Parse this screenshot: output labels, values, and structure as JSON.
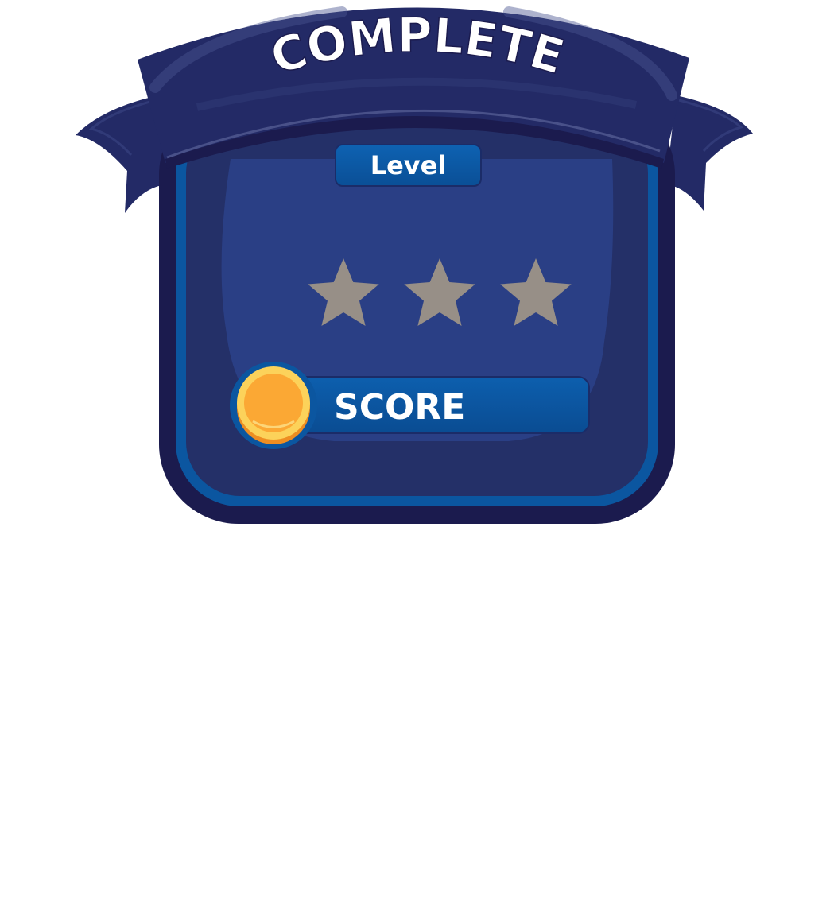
{
  "banner": {
    "title": "COMPLETE"
  },
  "level": {
    "label": "Level"
  },
  "stars": {
    "total": 3,
    "earned": 0,
    "empty_color": "#978f87"
  },
  "score": {
    "label": "SCORE",
    "coin_icon": "coin-icon"
  },
  "colors": {
    "panel_outer": "#1b1b4e",
    "panel_rim": "#0b56a0",
    "panel_inner": "#243068",
    "panel_glow": "#2a3f85",
    "banner": "#232a66",
    "button": "#0b56a0",
    "coin": "#fba834",
    "coin_rim": "#fcd25a",
    "text": "#ffffff"
  }
}
